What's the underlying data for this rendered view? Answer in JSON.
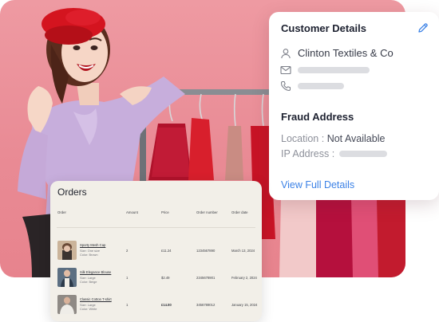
{
  "customer_card": {
    "title": "Customer Details",
    "company": "Clinton Textiles & Co",
    "fraud_title": "Fraud Address",
    "location_label": "Location :",
    "location_value": "Not Available",
    "ip_label": "IP Address :",
    "view_link": "View Full Details"
  },
  "orders_card": {
    "title": "Orders",
    "columns": [
      "Order",
      "Amount",
      "Price",
      "Order number",
      "Order date"
    ],
    "rows": [
      {
        "name": "Sporty Mesh Cap",
        "size": "Size: One size",
        "color": "Color: Brown",
        "amount": "2",
        "price": "£11.24",
        "order_number": "1234567890",
        "date": "March 13, 2024",
        "price_bold": false
      },
      {
        "name": "Silk Elegance Blouse",
        "size": "Size: Large",
        "color": "Color: Beige",
        "amount": "1",
        "price": "$2.49",
        "order_number": "2345678901",
        "date": "February 2, 2024",
        "price_bold": false
      },
      {
        "name": "Classic Cotton T-shirt",
        "size": "Size: Large",
        "color": "Color: White",
        "amount": "1",
        "price": "£14.80",
        "order_number": "3456789012",
        "date": "January 15, 2024",
        "price_bold": true
      }
    ]
  },
  "colors": {
    "accent_link": "#3c82e6",
    "hero_background": "#ec929b",
    "orders_background": "#f2efe8"
  },
  "icons": [
    "pencil-icon",
    "person-icon",
    "mail-icon",
    "phone-icon"
  ]
}
